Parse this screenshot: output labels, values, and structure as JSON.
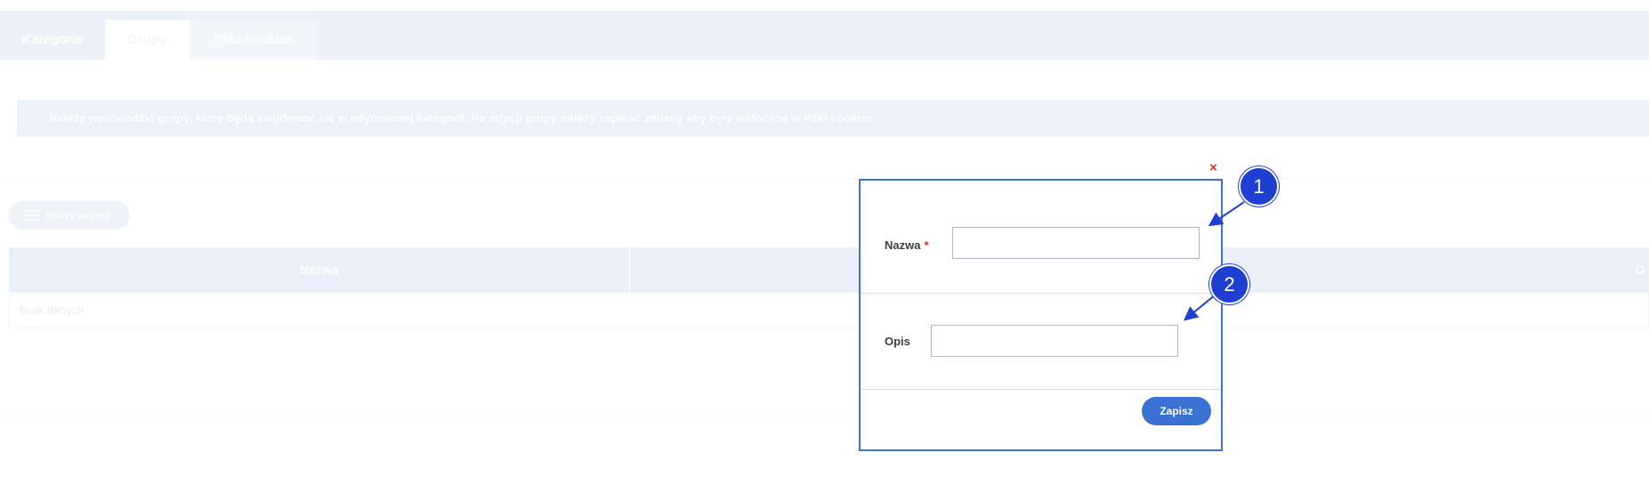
{
  "tabs": [
    "Kategorie",
    "Grupy",
    "Pliki cookies"
  ],
  "info_text": "Należy wprowadzić grupy, które będą znajdować się w edytowanej kategorii. Po edycji grupy należy zapisać zmiany aby były widoczne w Pliki cookies.",
  "new_row_label": "Nowy wiersz",
  "table": {
    "columns": [
      "Nazwa",
      "",
      "O"
    ],
    "empty_text": "Brak danych"
  },
  "dialog": {
    "close_icon": "×",
    "fields": [
      {
        "label": "Nazwa",
        "required_mark": "*",
        "value": "",
        "placeholder": ""
      },
      {
        "label": "Opis",
        "value": "",
        "placeholder": ""
      }
    ],
    "save_label": "Zapisz"
  },
  "callouts": [
    "1",
    "2"
  ],
  "colors": {
    "accent": "#3a72d4",
    "callout": "#1f3fd2",
    "required": "#d62828"
  }
}
